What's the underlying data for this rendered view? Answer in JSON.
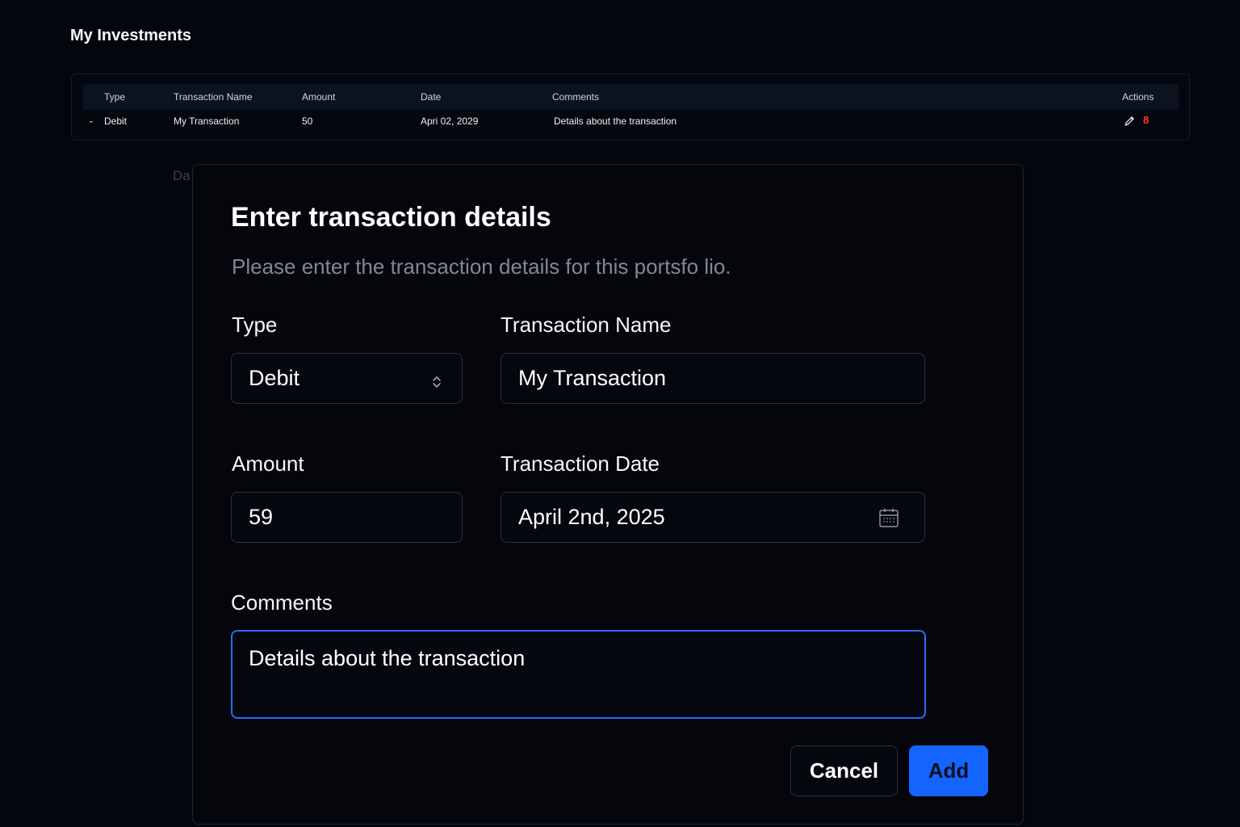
{
  "page": {
    "title": "My Investments"
  },
  "table": {
    "columns": [
      "Type",
      "Transaction Name",
      "Amount",
      "Date",
      "Comments",
      "Actions"
    ],
    "rows": [
      {
        "type_marker": "-",
        "type": "Debit",
        "name": "My Transaction",
        "amount": "50",
        "date": "Apri 02, 2029",
        "comments": "Details about the transaction",
        "delete_glyph": "8"
      }
    ]
  },
  "background_label": "Da",
  "modal": {
    "title": "Enter transaction details",
    "subtitle": "Please enter the transaction details for this portsfo lio.",
    "fields": {
      "type": {
        "label": "Type",
        "value": "Debit"
      },
      "name": {
        "label": "Transaction Name",
        "value": "My Transaction"
      },
      "amount": {
        "label": "Amount",
        "value": "59"
      },
      "date": {
        "label": "Transaction Date",
        "value": "April 2nd, 2025"
      },
      "comments": {
        "label": "Comments",
        "value": "Details about the transaction"
      }
    },
    "buttons": {
      "cancel": "Cancel",
      "add": "Add"
    }
  },
  "icons": {
    "edit": "pencil-icon",
    "delete": "delete-icon",
    "select": "chevron-up-down-icon",
    "date": "calendar-icon"
  },
  "colors": {
    "accent": "#1464ff",
    "focus_border": "#2f6bff",
    "debit_marker": "#f5c518",
    "delete": "#ff3b30"
  }
}
